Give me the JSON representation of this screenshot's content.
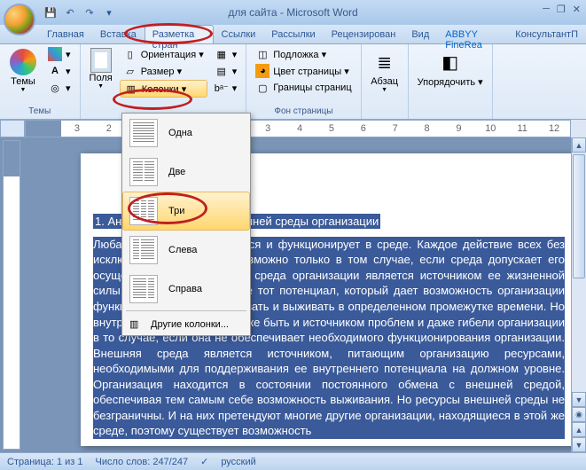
{
  "title": "для сайта - Microsoft Word",
  "tabs": [
    "Главная",
    "Вставка",
    "Разметка страницы",
    "Ссылки",
    "Рассылки",
    "Рецензирование",
    "Вид",
    "ABBYY FineReader",
    "КонсультантПлюс"
  ],
  "tabs_display": [
    "Главная",
    "Вставка",
    "Разметка стран",
    "Ссылки",
    "Рассылки",
    "Рецензирован",
    "Вид",
    "ABBYY FineRea",
    "КонсультантП"
  ],
  "active_tab": 2,
  "ribbon": {
    "themes": {
      "label": "Темы",
      "btn": "Темы"
    },
    "page_setup": {
      "margins": "Поля",
      "orientation": "Ориентация ▾",
      "size": "Размер ▾",
      "columns": "Колонки ▾",
      "breaks_icon": "▦",
      "line_numbers_icon": "▤",
      "hyphenation_icon": "bᵃ⁻"
    },
    "page_bg": {
      "label": "Фон страницы",
      "watermark": "Подложка ▾",
      "color": "Цвет страницы ▾",
      "borders": "Границы страниц"
    },
    "paragraph": {
      "label": "Абзац"
    },
    "arrange": {
      "label": "Упорядочить ▾"
    }
  },
  "columns_menu": {
    "one": "Одна",
    "two": "Две",
    "three": "Три",
    "left": "Слева",
    "right": "Справа",
    "more": "Другие колонки..."
  },
  "document": {
    "heading": "1. Анализ внешней и внутренней среды организации",
    "body": "Любая организация находится и функционирует в среде. Каждое действие всех без исключения организаций возможно только в том случае, если среда допускает его осуществление. Внутренняя среда организации является источником ее жизненной силы. Она заключает   в себе тот потенциал, который дает возможность организации функционировать, существовать и выживать в определенном промежутке времени. Но внутренняя среда может также быть и источником проблем   и даже гибели организации в то случае, если она не обеспечивает необходимого функционирования  организации. Внешняя  среда является источником, питающим организацию ресурсами, необходимыми для поддерживания ее внутреннего потенциала на должном уровне. Организация находится в состоянии постоянного обмена с внешней средой, обеспечивая тем самым себе возможность выживания. Но ресурсы внешней среды не безграничны. И на них претендуют многие другие организации, находящиеся в этой же среде, поэтому существует возможность"
  },
  "ruler_numbers": [
    "3",
    "2",
    "1",
    "",
    "1",
    "2",
    "3",
    "4",
    "5",
    "6",
    "7",
    "8",
    "9",
    "10",
    "11",
    "12"
  ],
  "status": {
    "page": "Страница: 1 из 1",
    "words": "Число слов: 247/247",
    "lang": "русский"
  }
}
